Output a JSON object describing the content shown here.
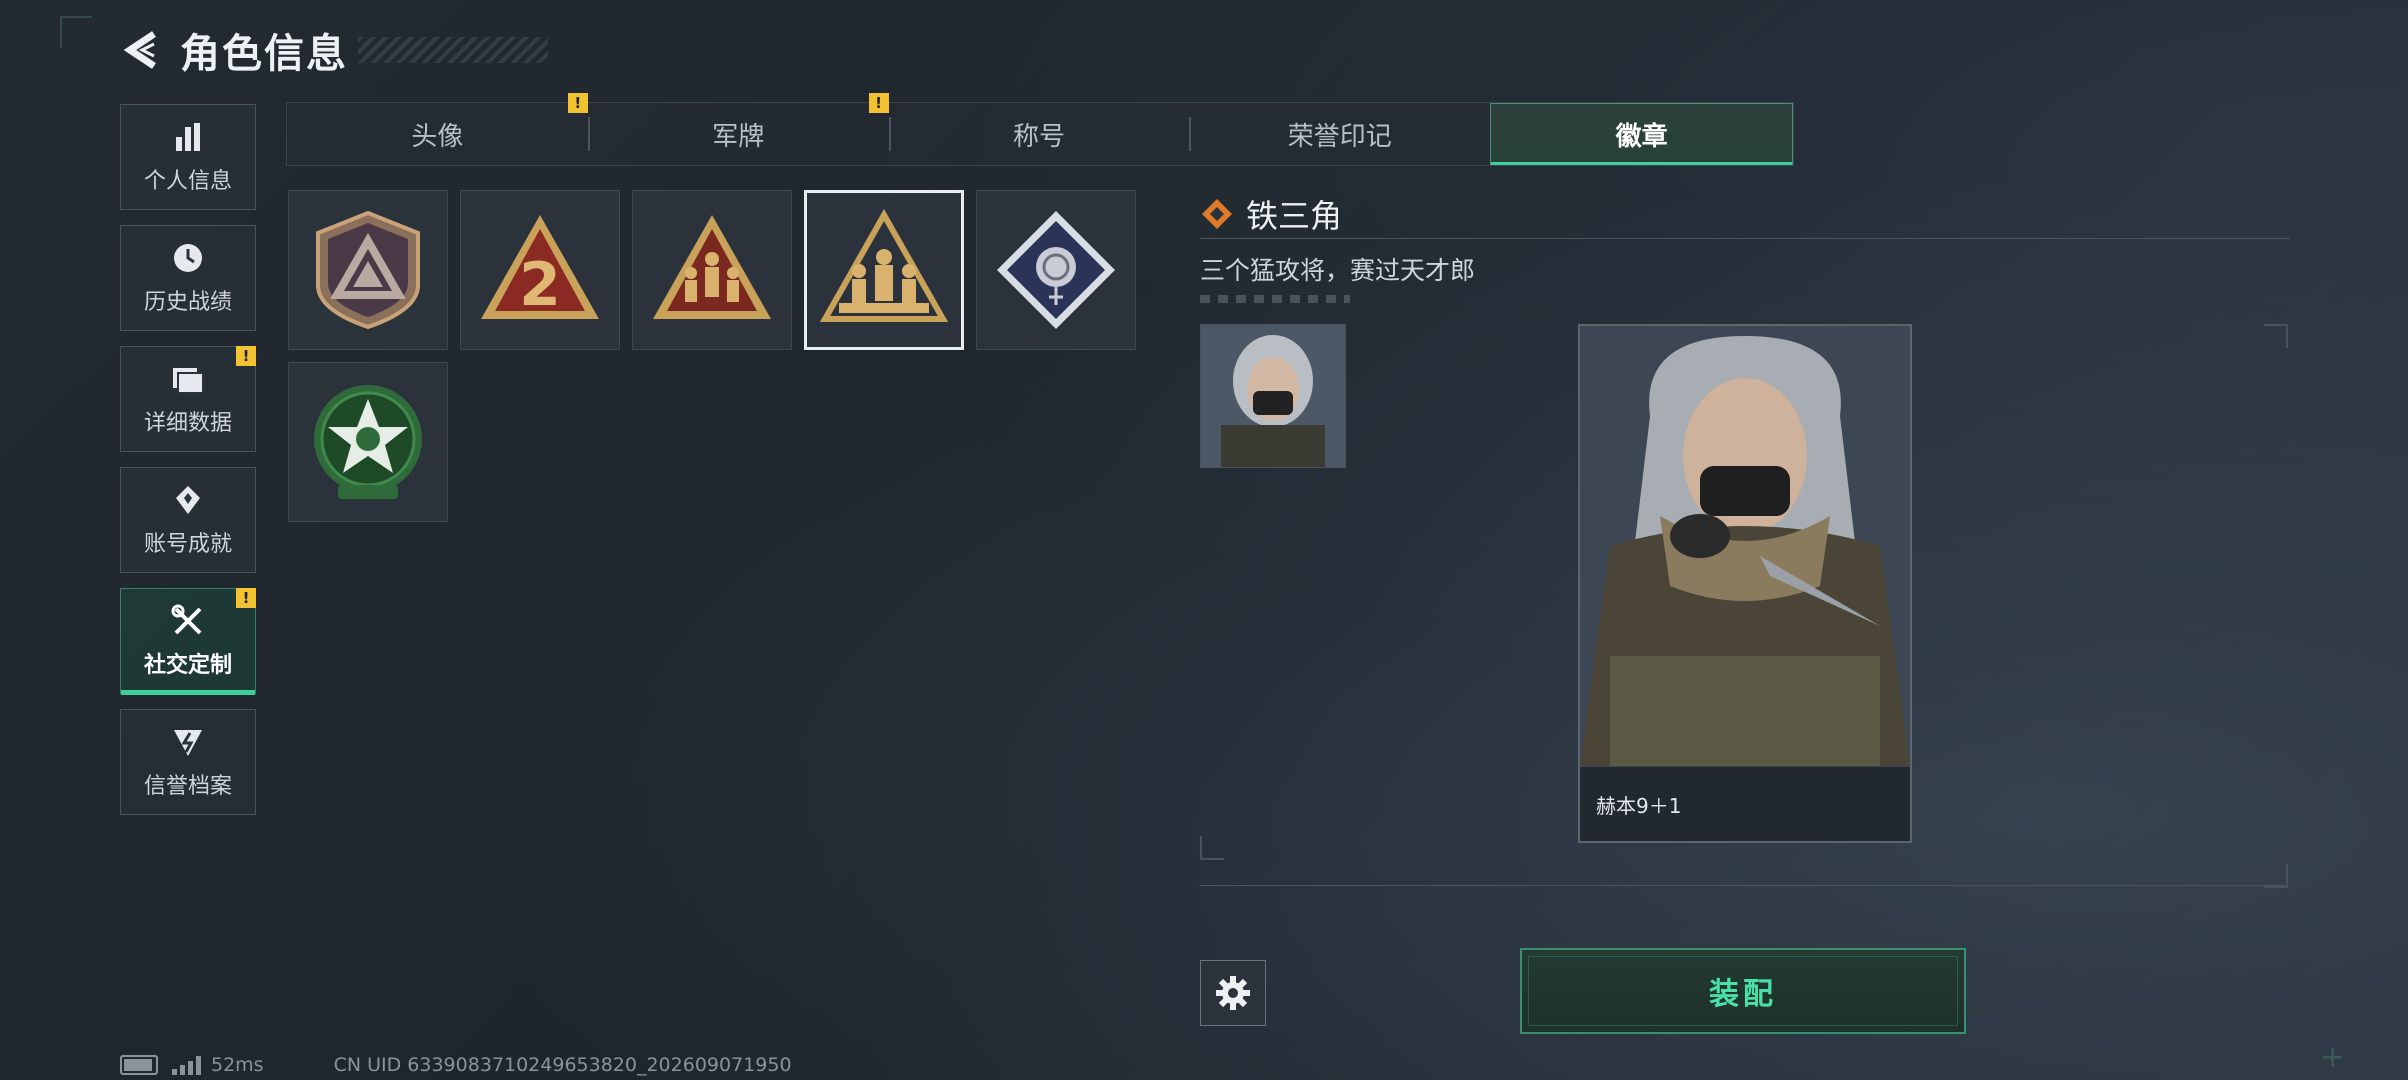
{
  "header": {
    "title": "角色信息",
    "back_icon": "back-arrow-icon"
  },
  "nav": {
    "items": [
      {
        "label": "个人信息",
        "icon": "bar-chart-icon",
        "alert": false
      },
      {
        "label": "历史战绩",
        "icon": "clock-icon",
        "alert": false
      },
      {
        "label": "详细数据",
        "icon": "folder-icon",
        "alert": true
      },
      {
        "label": "账号成就",
        "icon": "medal-icon",
        "alert": false
      },
      {
        "label": "社交定制",
        "icon": "tools-icon",
        "alert": true,
        "active": true
      },
      {
        "label": "信誉档案",
        "icon": "shield-bolt-icon",
        "alert": false
      }
    ],
    "alert_mark": "!"
  },
  "tabs": [
    {
      "label": "头像",
      "alert": true
    },
    {
      "label": "军牌",
      "alert": true
    },
    {
      "label": "称号",
      "alert": false
    },
    {
      "label": "荣誉印记",
      "alert": false
    },
    {
      "label": "徽章",
      "alert": false,
      "active": true
    }
  ],
  "badges": [
    {
      "icon": "shield-triangle-badge-icon",
      "selected": false
    },
    {
      "icon": "number-2-triangle-badge-icon",
      "selected": false
    },
    {
      "icon": "soldiers-triangle-badge-icon",
      "selected": false
    },
    {
      "icon": "soldiers-gold-triangle-badge-icon",
      "selected": true
    },
    {
      "icon": "rose-diamond-badge-icon",
      "selected": false
    },
    {
      "icon": "star-skull-green-badge-icon",
      "selected": false
    }
  ],
  "detail": {
    "name": "铁三角",
    "description": "三个猛攻将，赛过天才郎",
    "card_label": "赫本9＋1"
  },
  "actions": {
    "equip_label": "装配",
    "settings_icon": "gear-icon"
  },
  "status": {
    "ping": "52ms",
    "uid": "CN UID 6339083710249653820_202609071950"
  },
  "colors": {
    "accent": "#3fcf9a",
    "alert": "#f2c230",
    "equip_text": "#48e0a6"
  }
}
